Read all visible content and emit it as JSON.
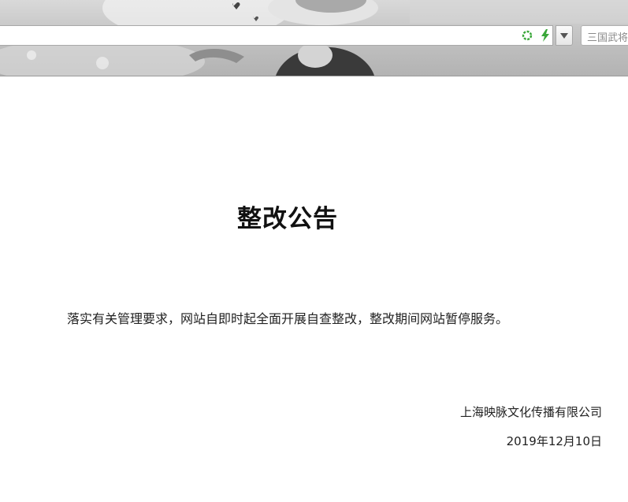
{
  "browser": {
    "address_url": "",
    "search_placeholder": "三国武将",
    "icons": [
      "security-ring-icon",
      "lightning-bolt-icon",
      "chevron-down-icon"
    ],
    "accent_green": "#3aa73a"
  },
  "notice": {
    "title": "整改公告",
    "body": "落实有关管理要求，网站自即时起全面开展自查整改，整改期间网站暂停服务。",
    "company": "上海映脉文化传播有限公司",
    "date": "2019年12月10日"
  }
}
